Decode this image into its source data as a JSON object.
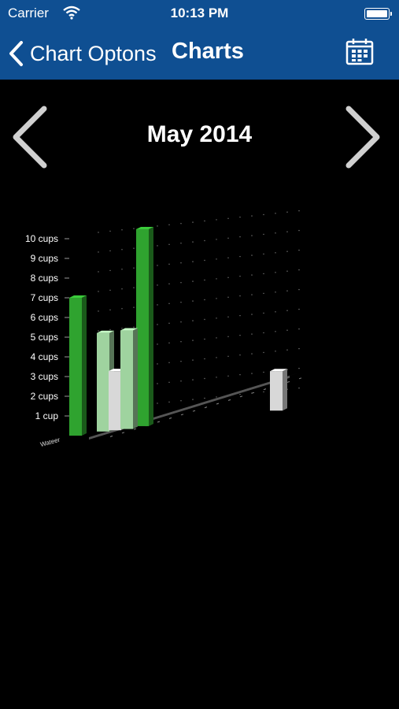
{
  "status_bar": {
    "carrier": "Carrier",
    "time": "10:13 PM"
  },
  "nav": {
    "back_label": "Chart Optons",
    "title": "Charts"
  },
  "month": {
    "title": "May 2014"
  },
  "colors": {
    "nav_bg": "#0f4f92",
    "bar_green": "#2fa32f",
    "bar_light_green": "#9fd39f",
    "bar_white": "#d8d8d8"
  },
  "icons": {
    "back": "chevron-left-icon",
    "calendar": "calendar-icon",
    "prev": "chevron-left-icon",
    "next": "chevron-right-icon",
    "wifi": "wifi-icon",
    "battery": "battery-icon"
  },
  "chart_data": {
    "type": "bar",
    "y_ticks": [
      "1 cup",
      "2 cups",
      "3 cups",
      "4 cups",
      "5 cups",
      "6 cups",
      "7 cups",
      "8 cups",
      "9 cups",
      "10 cups"
    ],
    "x_first_label": "Wateer",
    "ylim": [
      0,
      10
    ],
    "grid": true,
    "bars": [
      {
        "slot": 0,
        "depth": 0,
        "value": 7,
        "color": "#2fa32f"
      },
      {
        "slot": 2,
        "depth": 1,
        "value": 5,
        "color": "#9fd39f"
      },
      {
        "slot": 3,
        "depth": 1,
        "value": 3,
        "color": "#d8d8d8"
      },
      {
        "slot": 4,
        "depth": 1,
        "value": 5,
        "color": "#9fd39f"
      },
      {
        "slot": 5,
        "depth": 2,
        "value": 10,
        "color": "#2fa32f"
      },
      {
        "slot": 16,
        "depth": 3,
        "value": 2,
        "color": "#d8d8d8"
      }
    ]
  }
}
